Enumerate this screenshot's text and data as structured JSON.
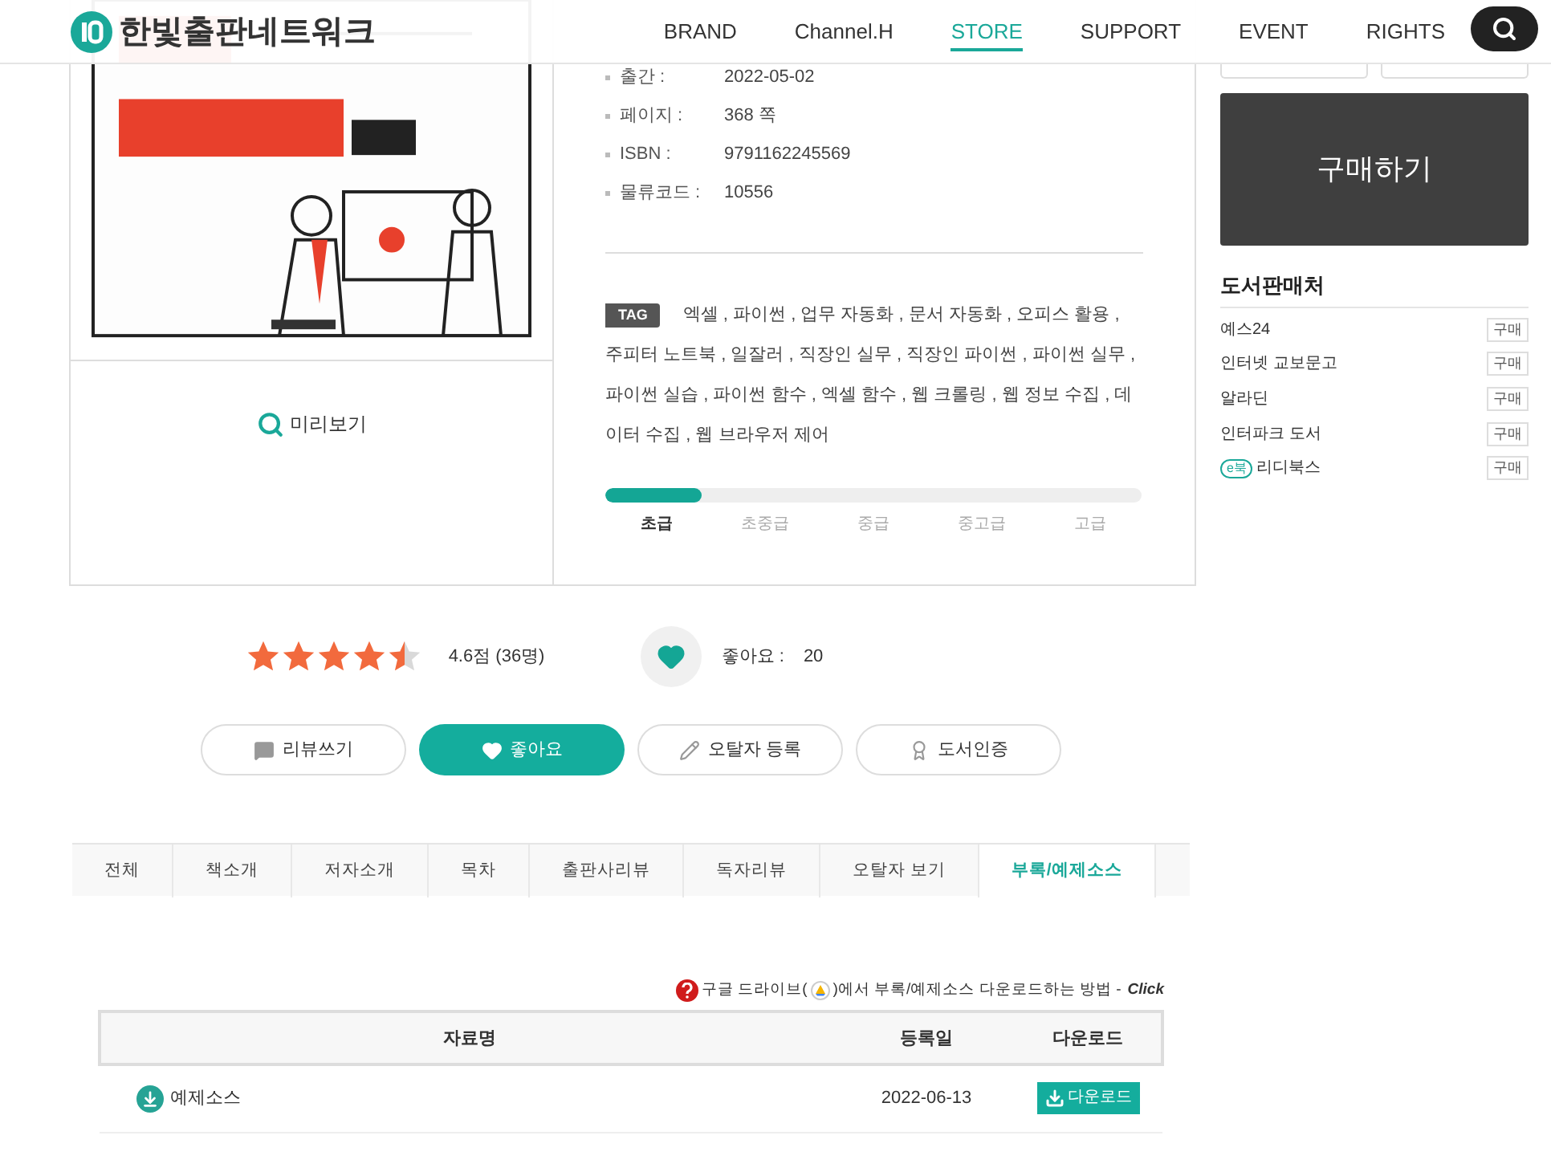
{
  "header": {
    "logo": "한빛출판네트워크",
    "nav": [
      {
        "label": "BRAND",
        "selected": false
      },
      {
        "label": "Channel.H",
        "selected": false
      },
      {
        "label": "STORE",
        "selected": true
      },
      {
        "label": "SUPPORT",
        "selected": false
      },
      {
        "label": "EVENT",
        "selected": false
      },
      {
        "label": "RIGHTS",
        "selected": false
      }
    ]
  },
  "cover": {
    "kind": "picture",
    "preview": "미리보기"
  },
  "info": [
    {
      "label": "출간 :",
      "value": "2022-05-02"
    },
    {
      "label": "페이지 :",
      "value": "368 쪽"
    },
    {
      "label": "ISBN :",
      "value": "9791162245569"
    },
    {
      "label": "물류코드 :",
      "value": "10556"
    }
  ],
  "tags": {
    "badge": "TAG",
    "text": "엑셀 , 파이썬 , 업무 자동화 , 문서 자동화 , 오피스 활용 , 주피터 노트북 , 일잘러 , 직장인 실무 , 직장인 파이썬 , 파이썬 실무 , 파이썬 실습 , 파이썬 함수 , 엑셀 함수 , 웹 크롤링 , 웹 정보 수집 , 데이터 수집 , 웹 브라우저 제어"
  },
  "difficulty": {
    "level": 0.18,
    "labels": [
      {
        "label": "초급",
        "selected": true
      },
      {
        "label": "초중급",
        "selected": false
      },
      {
        "label": "중급",
        "selected": false
      },
      {
        "label": "중고급",
        "selected": false
      },
      {
        "label": "고급",
        "selected": false
      }
    ]
  },
  "purchase": {
    "label": "구매하기"
  },
  "sellers": {
    "title": "도서판매처",
    "items": [
      {
        "name": "예스24",
        "ebook": false,
        "button": "구매"
      },
      {
        "name": "인터넷 교보문고",
        "ebook": false,
        "button": "구매"
      },
      {
        "name": "알라딘",
        "ebook": false,
        "button": "구매"
      },
      {
        "name": "인터파크 도서",
        "ebook": false,
        "button": "구매"
      },
      {
        "name": "리디북스",
        "ebook": true,
        "ebook_label": "e북",
        "button": "구매"
      }
    ]
  },
  "rating": {
    "stars": 4.5,
    "text": "4.6점 (36명)",
    "likes_label": "좋아요 :",
    "likes": "20"
  },
  "actions": [
    {
      "kind": "review",
      "label": "리뷰쓰기",
      "primary": false
    },
    {
      "kind": "like",
      "label": "좋아요",
      "primary": true
    },
    {
      "kind": "errata",
      "label": "오탈자 등록",
      "primary": false
    },
    {
      "kind": "cert",
      "label": "도서인증",
      "primary": false
    }
  ],
  "tabs": [
    {
      "label": "전체",
      "selected": false
    },
    {
      "label": "책소개",
      "selected": false
    },
    {
      "label": "저자소개",
      "selected": false
    },
    {
      "label": "목차",
      "selected": false
    },
    {
      "label": "출판사리뷰",
      "selected": false
    },
    {
      "label": "독자리뷰",
      "selected": false
    },
    {
      "label": "오탈자 보기",
      "selected": false
    },
    {
      "label": "부록/예제소스",
      "selected": true
    }
  ],
  "help": {
    "before": "구글 드라이브(",
    "after": ")에서 부록/예제소스 다운로드하는 방법 -",
    "link": "Click"
  },
  "table": {
    "columns": [
      "자료명",
      "등록일",
      "다운로드"
    ],
    "rows": [
      {
        "name": "예제소스",
        "date": "2022-06-13",
        "button": "다운로드"
      }
    ]
  }
}
